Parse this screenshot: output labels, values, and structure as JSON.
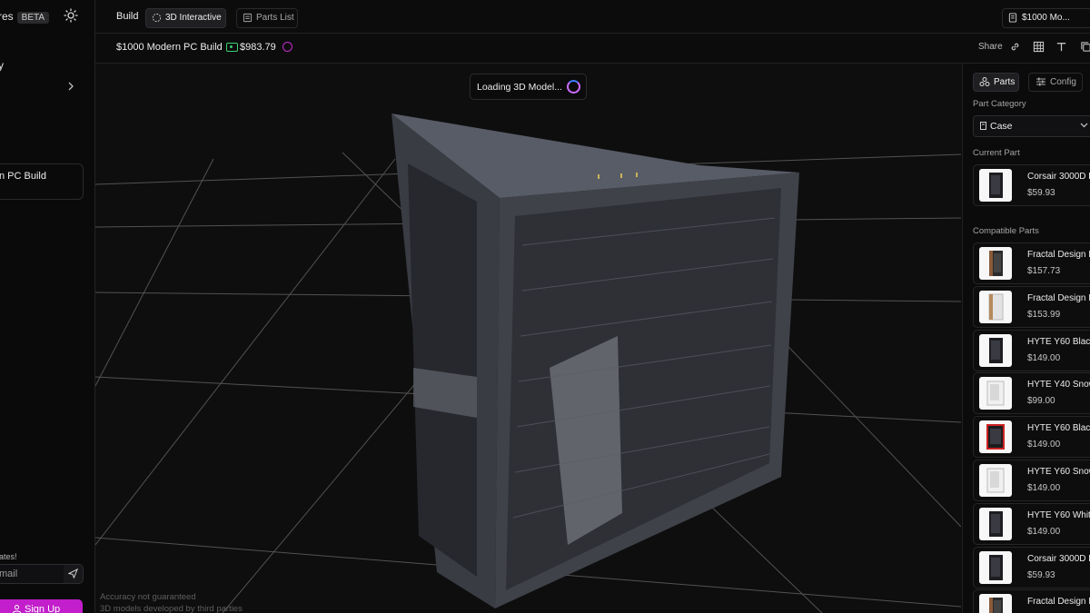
{
  "sidebar": {
    "brand_fragment": "res",
    "beta_badge": "BETA",
    "nav_item_1": "ry",
    "nav_item_2": "s",
    "saved_build_fragment": "n PC Build",
    "updates_fragment": "dates!",
    "email_placeholder_fragment": "mail",
    "sign_up_label": "Sign Up"
  },
  "topbar": {
    "build_label": "Build",
    "tab_3d_label": "3D Interactive",
    "tab_parts_label": "Parts List",
    "build_select_value": "$1000 Mo..."
  },
  "subbar": {
    "build_name": "$1000 Modern PC Build",
    "total_price": "$983.79",
    "share_label": "Share"
  },
  "viewport": {
    "loading_text": "Loading 3D Model...",
    "disclaimer_1": "Accuracy not guaranteed",
    "disclaimer_2": "3D models developed by third parties"
  },
  "right_panel": {
    "tab_parts_label": "Parts",
    "tab_config_label": "Config",
    "part_category_label": "Part Category",
    "part_category_value": "Case",
    "current_part_label": "Current Part",
    "current_part": {
      "name": "Corsair 3000D R",
      "price": "$59.93",
      "thumb": "black"
    },
    "compatible_parts_label": "Compatible Parts",
    "compatible_parts": [
      {
        "name": "Fractal Design N",
        "price": "$157.73",
        "thumb": "wood"
      },
      {
        "name": "Fractal Design N",
        "price": "$153.99",
        "thumb": "white-wood"
      },
      {
        "name": "HYTE Y60 Black",
        "price": "$149.00",
        "thumb": "black"
      },
      {
        "name": "HYTE Y40 Snow",
        "price": "$99.00",
        "thumb": "white"
      },
      {
        "name": "HYTE Y60 Black",
        "price": "$149.00",
        "thumb": "red"
      },
      {
        "name": "HYTE Y60 Snow",
        "price": "$149.00",
        "thumb": "white"
      },
      {
        "name": "HYTE Y60 White",
        "price": "$149.00",
        "thumb": "black"
      },
      {
        "name": "Corsair 3000D R",
        "price": "$59.93",
        "thumb": "black"
      },
      {
        "name": "Fractal Design N",
        "price": "",
        "thumb": "wood"
      }
    ]
  },
  "colors": {
    "accent": "#c21ecb",
    "price_icon": "#3bd16f",
    "background": "#0b0b0c"
  }
}
